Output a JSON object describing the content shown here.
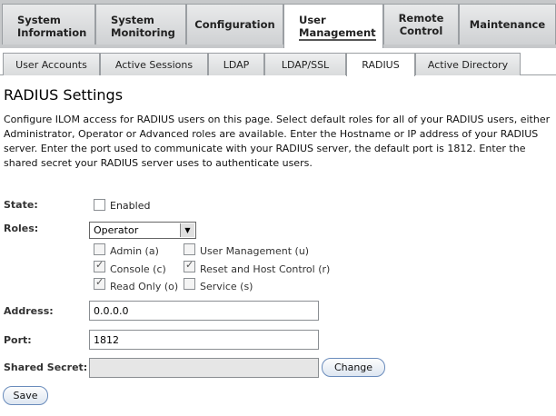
{
  "top_tabs": [
    {
      "line1": "System",
      "line2": "Information"
    },
    {
      "line1": "System",
      "line2": "Monitoring"
    },
    {
      "line1": "Configuration",
      "line2": ""
    },
    {
      "line1": "User",
      "line2": "Management"
    },
    {
      "line1": "Remote",
      "line2": "Control"
    },
    {
      "line1": "Maintenance",
      "line2": ""
    }
  ],
  "sub_tabs": [
    "User Accounts",
    "Active Sessions",
    "LDAP",
    "LDAP/SSL",
    "RADIUS",
    "Active Directory"
  ],
  "page": {
    "title": "RADIUS Settings",
    "description": "Configure ILOM access for RADIUS users on this page. Select default roles for all of your RADIUS users, either Administrator, Operator or Advanced roles are available. Enter the Hostname or IP address of your RADIUS server. Enter the port used to communicate with your RADIUS server, the default port is 1812. Enter the shared secret your RADIUS server uses to authenticate users."
  },
  "form": {
    "state_label": "State:",
    "enabled_label": "Enabled",
    "enabled_checked": false,
    "roles_label": "Roles:",
    "roles_selected": "Operator",
    "roles_checkboxes": [
      {
        "label": "Admin (a)",
        "checked": false
      },
      {
        "label": "User Management (u)",
        "checked": false
      },
      {
        "label": "Console (c)",
        "checked": true
      },
      {
        "label": "Reset and Host Control (r)",
        "checked": true
      },
      {
        "label": "Read Only (o)",
        "checked": true
      },
      {
        "label": "Service (s)",
        "checked": false
      }
    ],
    "address_label": "Address:",
    "address_value": "0.0.0.0",
    "port_label": "Port:",
    "port_value": "1812",
    "secret_label": "Shared Secret:",
    "secret_value": "",
    "change_button": "Change",
    "save_button": "Save"
  }
}
